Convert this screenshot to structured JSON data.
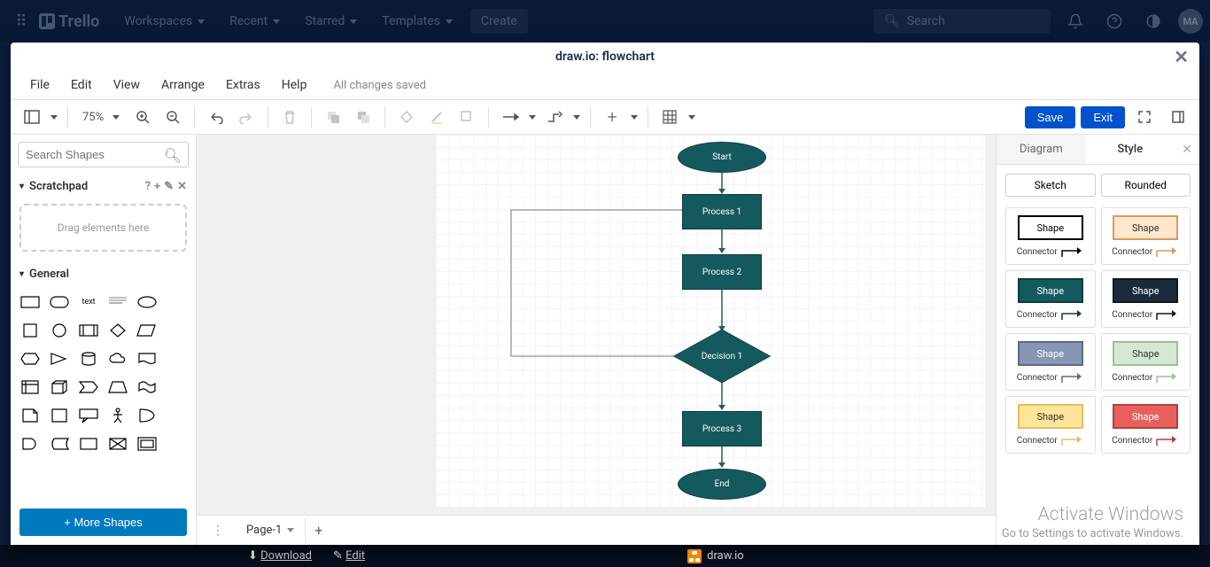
{
  "trello": {
    "logo_text": "Trello",
    "nav": [
      "Workspaces",
      "Recent",
      "Starred",
      "Templates"
    ],
    "create_label": "Create",
    "search_placeholder": "Search",
    "avatar_initials": "MA"
  },
  "drawio": {
    "title": "draw.io: flowchart",
    "menus": [
      "File",
      "Edit",
      "View",
      "Arrange",
      "Extras",
      "Help"
    ],
    "save_status": "All changes saved",
    "zoom_value": "75%",
    "save_btn": "Save",
    "exit_btn": "Exit",
    "left": {
      "search_placeholder": "Search Shapes",
      "scratchpad_label": "Scratchpad",
      "scratchpad_drop": "Drag elements here",
      "general_label": "General",
      "more_shapes": "+ More Shapes"
    },
    "flowchart": {
      "start": "Start",
      "p1": "Process 1",
      "p2": "Process 2",
      "d1": "Decision 1",
      "p3": "Process 3",
      "end": "End"
    },
    "pages": {
      "page1": "Page-1"
    },
    "right": {
      "tab_diagram": "Diagram",
      "tab_style": "Style",
      "sketch": "Sketch",
      "rounded": "Rounded",
      "shape_label": "Shape",
      "connector_label": "Connector"
    }
  },
  "bottom_bar": {
    "download": "Download",
    "edit": "Edit",
    "app_name": "draw.io"
  },
  "watermark": {
    "line1": "Activate Windows",
    "line2": "Go to Settings to activate Windows."
  },
  "style_swatches": [
    {
      "bg": "#ffffff",
      "border": "#000000",
      "fg": "#000000"
    },
    {
      "bg": "#ffe6cc",
      "border": "#d79b5e",
      "fg": "#333333"
    },
    {
      "bg": "#14595e",
      "border": "#0d3d40",
      "fg": "#ffffff"
    },
    {
      "bg": "#1a2c3b",
      "border": "#0d1820",
      "fg": "#ffffff"
    },
    {
      "bg": "#8696b3",
      "border": "#5a6a85",
      "fg": "#ffffff"
    },
    {
      "bg": "#d5e8d4",
      "border": "#9cc192",
      "fg": "#333333"
    },
    {
      "bg": "#ffe599",
      "border": "#e6bc5c",
      "fg": "#333333"
    },
    {
      "bg": "#e8605c",
      "border": "#b33f3c",
      "fg": "#ffffff"
    }
  ]
}
